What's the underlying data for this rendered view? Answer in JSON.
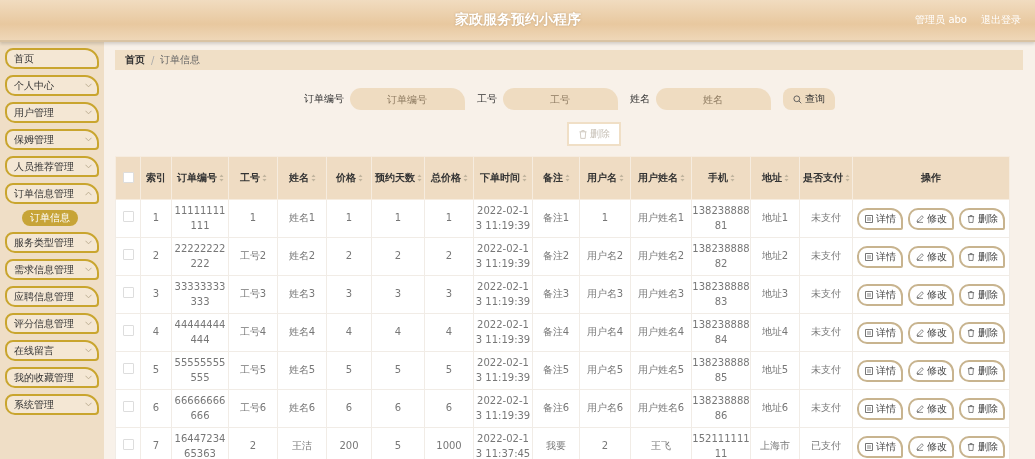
{
  "header": {
    "title": "家政服务预约小程序",
    "user": "管理员 abo",
    "logout": "退出登录"
  },
  "sidebar": {
    "items": [
      {
        "label": "首页",
        "kind": "link"
      },
      {
        "label": "个人中心",
        "kind": "menu",
        "expanded": false
      },
      {
        "label": "用户管理",
        "kind": "menu",
        "expanded": false
      },
      {
        "label": "保姆管理",
        "kind": "menu",
        "expanded": false
      },
      {
        "label": "人员推荐管理",
        "kind": "menu",
        "expanded": false
      },
      {
        "label": "订单信息管理",
        "kind": "menu",
        "expanded": true,
        "children": [
          {
            "label": "订单信息",
            "selected": true
          }
        ]
      },
      {
        "label": "服务类型管理",
        "kind": "menu",
        "expanded": false
      },
      {
        "label": "需求信息管理",
        "kind": "menu",
        "expanded": false
      },
      {
        "label": "应聘信息管理",
        "kind": "menu",
        "expanded": false
      },
      {
        "label": "评分信息管理",
        "kind": "menu",
        "expanded": false
      },
      {
        "label": "在线留言",
        "kind": "menu",
        "expanded": false
      },
      {
        "label": "我的收藏管理",
        "kind": "menu",
        "expanded": false
      },
      {
        "label": "系统管理",
        "kind": "menu",
        "expanded": false
      }
    ]
  },
  "breadcrumb": {
    "items": [
      "首页",
      "订单信息"
    ],
    "separator": "/"
  },
  "search": {
    "fields": [
      {
        "label": "订单编号",
        "placeholder": "订单编号"
      },
      {
        "label": "工号",
        "placeholder": "工号"
      },
      {
        "label": "姓名",
        "placeholder": "姓名"
      }
    ],
    "button": "查询"
  },
  "delete_button": {
    "label": "删除",
    "disabled": true
  },
  "table": {
    "select_all": false,
    "columns": [
      {
        "label": "索引",
        "sortable": false
      },
      {
        "label": "订单编号",
        "sortable": true
      },
      {
        "label": "工号",
        "sortable": true
      },
      {
        "label": "姓名",
        "sortable": true
      },
      {
        "label": "价格",
        "sortable": true
      },
      {
        "label": "预约天数",
        "sortable": true
      },
      {
        "label": "总价格",
        "sortable": true
      },
      {
        "label": "下单时间",
        "sortable": true
      },
      {
        "label": "备注",
        "sortable": true
      },
      {
        "label": "用户名",
        "sortable": true
      },
      {
        "label": "用户姓名",
        "sortable": true
      },
      {
        "label": "手机",
        "sortable": true
      },
      {
        "label": "地址",
        "sortable": true
      },
      {
        "label": "是否支付",
        "sortable": true
      },
      {
        "label": "操作",
        "sortable": false
      }
    ],
    "rows": [
      {
        "checked": false,
        "cells": [
          "1",
          "11111111111",
          "1",
          "姓名1",
          "1",
          "1",
          "1",
          "2022-02-13 11:19:39",
          "备注1",
          "1",
          "用户姓名1",
          "13823888881",
          "地址1",
          "未支付"
        ],
        "actions": [
          {
            "kind": "detail",
            "label": "详情"
          },
          {
            "kind": "edit",
            "label": "修改"
          },
          {
            "kind": "delete",
            "label": "删除"
          }
        ]
      },
      {
        "checked": false,
        "cells": [
          "2",
          "22222222222",
          "工号2",
          "姓名2",
          "2",
          "2",
          "2",
          "2022-02-13 11:19:39",
          "备注2",
          "用户名2",
          "用户姓名2",
          "13823888882",
          "地址2",
          "未支付"
        ],
        "actions": [
          {
            "kind": "detail",
            "label": "详情"
          },
          {
            "kind": "edit",
            "label": "修改"
          },
          {
            "kind": "delete",
            "label": "删除"
          }
        ]
      },
      {
        "checked": false,
        "cells": [
          "3",
          "33333333333",
          "工号3",
          "姓名3",
          "3",
          "3",
          "3",
          "2022-02-13 11:19:39",
          "备注3",
          "用户名3",
          "用户姓名3",
          "13823888883",
          "地址3",
          "未支付"
        ],
        "actions": [
          {
            "kind": "detail",
            "label": "详情"
          },
          {
            "kind": "edit",
            "label": "修改"
          },
          {
            "kind": "delete",
            "label": "删除"
          }
        ]
      },
      {
        "checked": false,
        "cells": [
          "4",
          "44444444444",
          "工号4",
          "姓名4",
          "4",
          "4",
          "4",
          "2022-02-13 11:19:39",
          "备注4",
          "用户名4",
          "用户姓名4",
          "13823888884",
          "地址4",
          "未支付"
        ],
        "actions": [
          {
            "kind": "detail",
            "label": "详情"
          },
          {
            "kind": "edit",
            "label": "修改"
          },
          {
            "kind": "delete",
            "label": "删除"
          }
        ]
      },
      {
        "checked": false,
        "cells": [
          "5",
          "55555555555",
          "工号5",
          "姓名5",
          "5",
          "5",
          "5",
          "2022-02-13 11:19:39",
          "备注5",
          "用户名5",
          "用户姓名5",
          "13823888885",
          "地址5",
          "未支付"
        ],
        "actions": [
          {
            "kind": "detail",
            "label": "详情"
          },
          {
            "kind": "edit",
            "label": "修改"
          },
          {
            "kind": "delete",
            "label": "删除"
          }
        ]
      },
      {
        "checked": false,
        "cells": [
          "6",
          "66666666666",
          "工号6",
          "姓名6",
          "6",
          "6",
          "6",
          "2022-02-13 11:19:39",
          "备注6",
          "用户名6",
          "用户姓名6",
          "13823888886",
          "地址6",
          "未支付"
        ],
        "actions": [
          {
            "kind": "detail",
            "label": "详情"
          },
          {
            "kind": "edit",
            "label": "修改"
          },
          {
            "kind": "delete",
            "label": "删除"
          }
        ]
      },
      {
        "checked": false,
        "cells": [
          "7",
          "1644723465363",
          "2",
          "王洁",
          "200",
          "5",
          "1000",
          "2022-02-13 11:37:45",
          "我要",
          "2",
          "王飞",
          "15211111111",
          "上海市",
          "已支付"
        ],
        "actions": [
          {
            "kind": "detail",
            "label": "详情"
          },
          {
            "kind": "edit",
            "label": "修改"
          },
          {
            "kind": "delete",
            "label": "删除"
          }
        ]
      }
    ]
  }
}
